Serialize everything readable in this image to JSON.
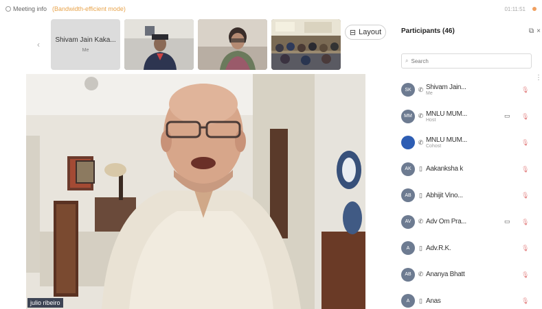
{
  "topbar": {
    "meeting_info": "Meeting info",
    "mode": "(Bandwidth-efficient mode)",
    "timer": "01:11:51"
  },
  "thumbnails": [
    {
      "name": "Shivam Jain Kaka...",
      "sub": "Me"
    }
  ],
  "layout_button": {
    "label": "Layout"
  },
  "main_video": {
    "name_tag": "julio ribeiro"
  },
  "panel": {
    "title": "Participants (46)",
    "search_placeholder": "Search",
    "participants": [
      {
        "initials": "SK",
        "name": "Shivam Jain...",
        "role": "Me",
        "color": "#6d7b91",
        "status": "phone",
        "cam": false
      },
      {
        "initials": "MM",
        "name": "MNLU MUM...",
        "role": "Host",
        "color": "#6d7b91",
        "status": "phone",
        "cam": true
      },
      {
        "initials": "",
        "name": "MNLU MUM...",
        "role": "Cohost",
        "color": "#2d5db3",
        "status": "phone",
        "cam": false
      },
      {
        "initials": "AK",
        "name": "Aakanksha k",
        "role": "",
        "color": "#6d7b91",
        "status": "desktop",
        "cam": false
      },
      {
        "initials": "AB",
        "name": "Abhijit Vino...",
        "role": "",
        "color": "#6d7b91",
        "status": "desktop",
        "cam": false
      },
      {
        "initials": "AV",
        "name": "Adv Om Pra...",
        "role": "",
        "color": "#6d7b91",
        "status": "phone",
        "cam": true
      },
      {
        "initials": "A",
        "name": "Adv.R.K.",
        "role": "",
        "color": "#6d7b91",
        "status": "desktop",
        "cam": false
      },
      {
        "initials": "AB",
        "name": "Ananya Bhatt",
        "role": "",
        "color": "#6d7b91",
        "status": "phone",
        "cam": false
      },
      {
        "initials": "A",
        "name": "Anas",
        "role": "",
        "color": "#6d7b91",
        "status": "desktop",
        "cam": false
      }
    ]
  }
}
